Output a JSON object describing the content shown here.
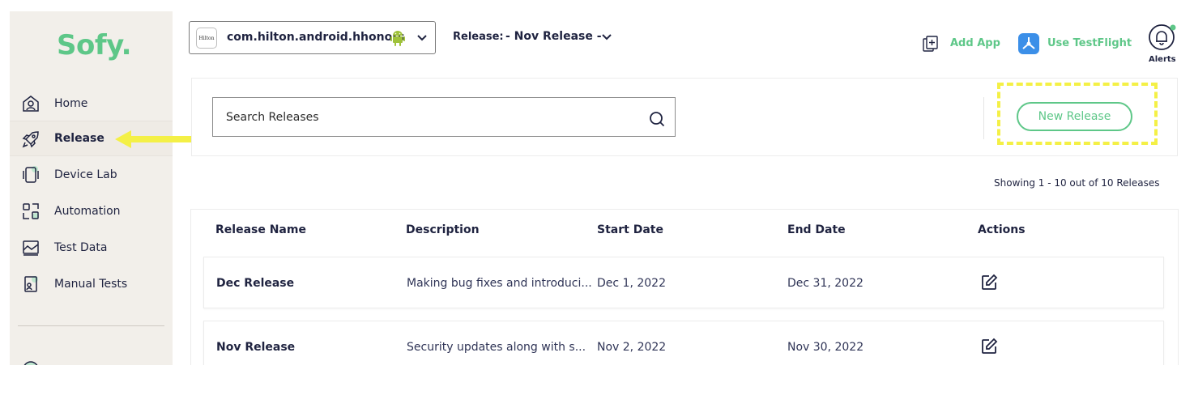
{
  "sidebar": {
    "logo": "Sofy.",
    "items": [
      {
        "label": "Home",
        "icon": "home-icon",
        "active": false
      },
      {
        "label": "Release",
        "icon": "rocket-icon",
        "active": true
      },
      {
        "label": "Device Lab",
        "icon": "device-icon",
        "active": false
      },
      {
        "label": "Automation",
        "icon": "automation-icon",
        "active": false
      },
      {
        "label": "Test Data",
        "icon": "test-data-icon",
        "active": false
      },
      {
        "label": "Manual Tests",
        "icon": "manual-tests-icon",
        "active": false
      }
    ]
  },
  "header": {
    "app_logo_text": "Hilton",
    "app_name": "com.hilton.android.hhonors",
    "release_label": "Release:",
    "release_value": "- Nov Release -",
    "add_app_label": "Add App",
    "testflight_label": "Use TestFlight",
    "alerts_label": "Alerts"
  },
  "search": {
    "placeholder": "Search Releases"
  },
  "actions": {
    "new_release_label": "New Release"
  },
  "showing_text": "Showing 1 - 10 out of 10 Releases",
  "table": {
    "headers": [
      "Release Name",
      "Description",
      "Start Date",
      "End Date",
      "Actions"
    ],
    "rows": [
      {
        "name": "Dec Release",
        "description": "Making bug fixes and introduci...",
        "start": "Dec 1, 2022",
        "end": "Dec 31, 2022"
      },
      {
        "name": "Nov Release",
        "description": "Security updates along with s...",
        "start": "Nov 2, 2022",
        "end": "Nov 30, 2022"
      }
    ]
  },
  "colors": {
    "brand_green": "#5ec788",
    "highlight_yellow": "#f4f046",
    "sidebar_bg": "#f2efea",
    "text_dark": "#1f2340"
  }
}
